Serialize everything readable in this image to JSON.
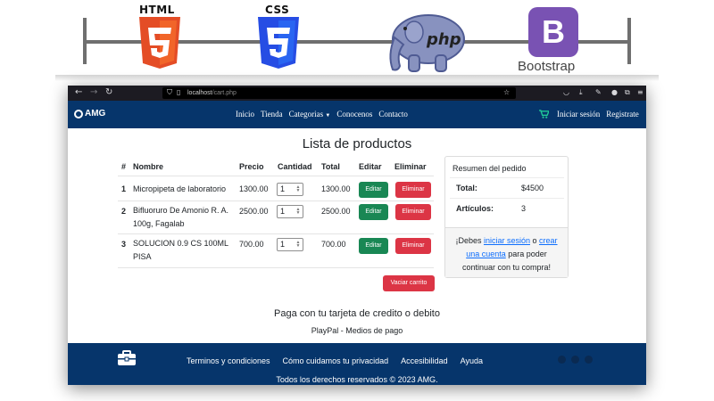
{
  "banner": {
    "html_label": "HTML",
    "css_label": "CSS",
    "php_label": "php",
    "bootstrap_letter": "B",
    "bootstrap_label": "Bootstrap"
  },
  "browser": {
    "back_icon": "arrow-left-icon",
    "forward_icon": "arrow-right-icon",
    "reload_icon": "reload-icon",
    "url_host": "localhost",
    "url_path": "/cart.php"
  },
  "navbar": {
    "brand": "AMG",
    "links": [
      "Inicio",
      "Tienda",
      "Categorias",
      "Conocenos",
      "Contacto"
    ],
    "login": "Iniciar sesión",
    "register": "Registrate"
  },
  "page": {
    "title": "Lista de productos"
  },
  "table": {
    "headers": [
      "#",
      "Nombre",
      "Precio",
      "Cantidad",
      "Total",
      "Editar",
      "Eliminar"
    ],
    "rows": [
      {
        "num": "1",
        "name": "Micropipeta de laboratorio",
        "price": "1300.00",
        "qty": "1",
        "total": "1300.00",
        "edit": "Editar",
        "delete": "Eliminar"
      },
      {
        "num": "2",
        "name": "Bifluoruro De Amonio R. A. 100g, Fagalab",
        "price": "2500.00",
        "qty": "1",
        "total": "2500.00",
        "edit": "Editar",
        "delete": "Eliminar"
      },
      {
        "num": "3",
        "name": "SOLUCION 0.9 CS 100ML PISA",
        "price": "700.00",
        "qty": "1",
        "total": "700.00",
        "edit": "Editar",
        "delete": "Eliminar"
      }
    ],
    "clear_button": "Vaciar carrito"
  },
  "summary": {
    "title": "Resumen del pedido",
    "total_label": "Total:",
    "total_value": "$4500",
    "items_label": "Artículos:",
    "items_value": "3",
    "note_prefix": "¡Debes ",
    "login_link": "iniciar sesión",
    "note_or": " o ",
    "create_link": "crear una cuenta",
    "note_suffix": " para poder continuar con tu compra!"
  },
  "payment": {
    "title": "Paga con tu tarjeta de credito o debito",
    "subtitle": "PlayPal - Medios de pago"
  },
  "footer": {
    "links": [
      "Terminos y condiciones",
      "Cómo cuidamos tu privacidad",
      "Accesibilidad",
      "Ayuda"
    ],
    "copyright": "Todos los derechos reservados © 2023 AMG."
  },
  "colors": {
    "navy": "#06356b",
    "success": "#198754",
    "danger": "#dc3545",
    "link": "#0d6efd",
    "html_orange": "#e44d26",
    "css_blue": "#264de4",
    "php_purple": "#8892bf",
    "bootstrap_purple": "#7952b3"
  }
}
